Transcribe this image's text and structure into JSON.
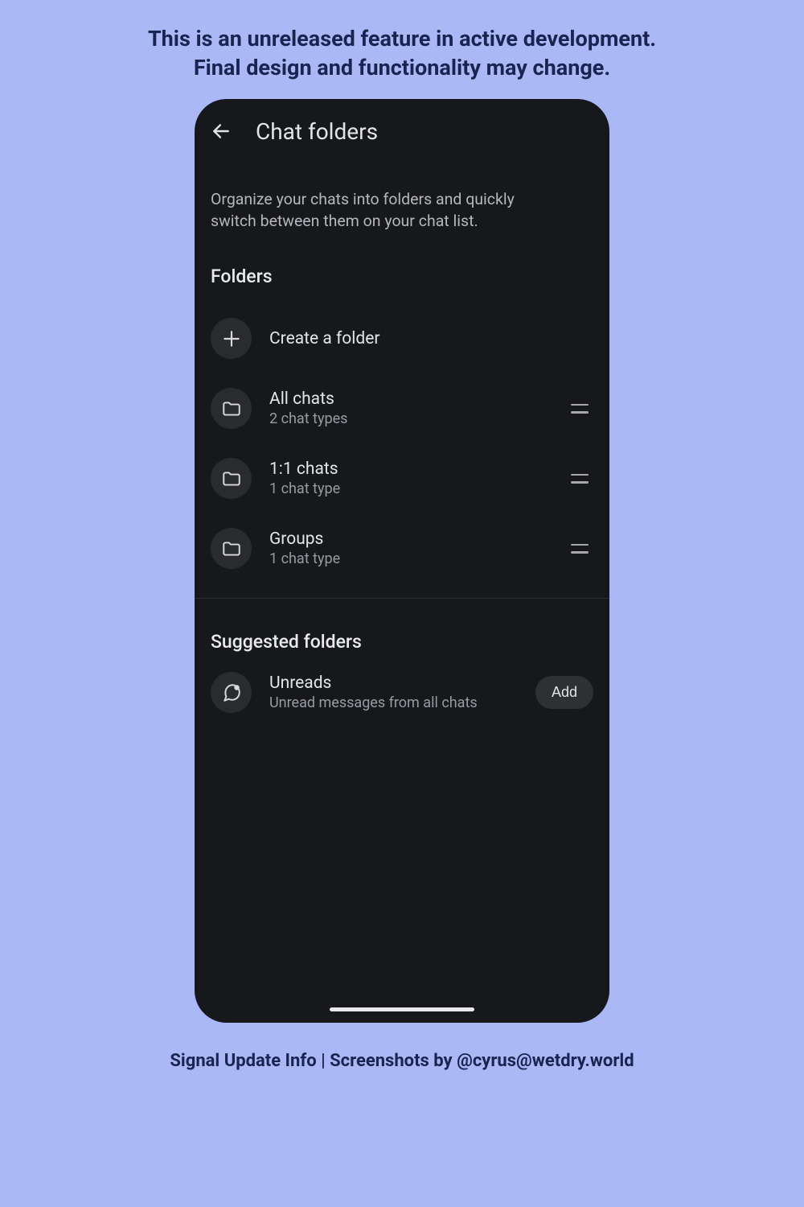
{
  "banner": {
    "line1": "This is an unreleased feature in active development.",
    "line2": "Final design and functionality may change."
  },
  "header": {
    "title": "Chat folders"
  },
  "description": "Organize your chats into folders and quickly switch between them on your chat list.",
  "sections": {
    "folders_title": "Folders",
    "suggested_title": "Suggested folders"
  },
  "create": {
    "label": "Create a folder"
  },
  "folders": [
    {
      "name": "All chats",
      "sub": "2 chat types"
    },
    {
      "name": "1:1 chats",
      "sub": "1 chat type"
    },
    {
      "name": "Groups",
      "sub": "1 chat type"
    }
  ],
  "suggested": [
    {
      "name": "Unreads",
      "sub": "Unread messages from all chats",
      "action": "Add"
    }
  ],
  "footer": "Signal Update Info | Screenshots by @cyrus@wetdry.world"
}
